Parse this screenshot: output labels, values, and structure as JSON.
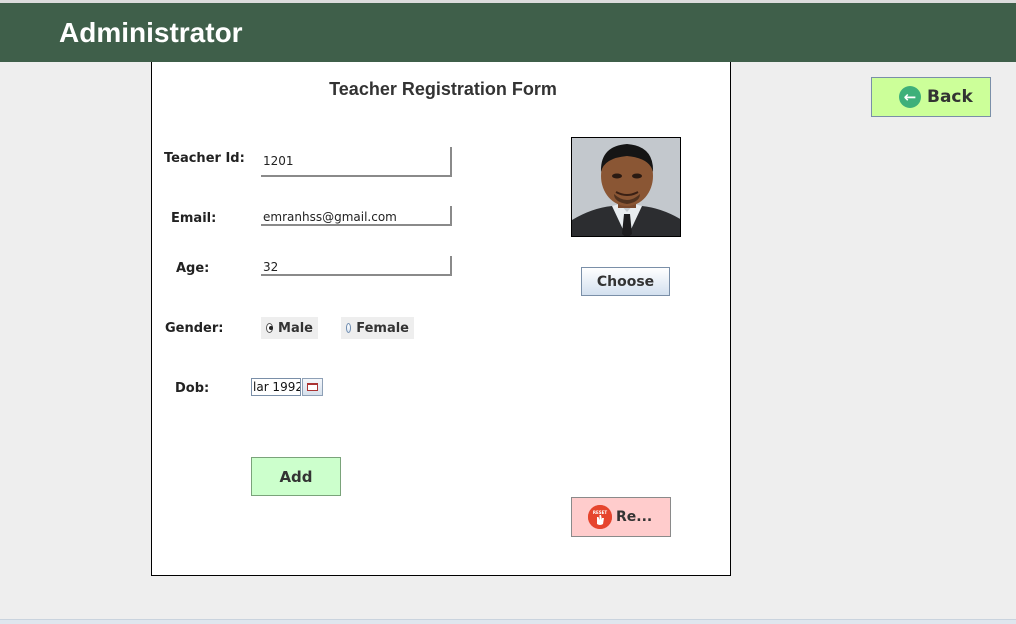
{
  "header": {
    "title": "Administrator"
  },
  "form": {
    "title": "Teacher Registration Form",
    "teacher_id": {
      "label": "Teacher Id:",
      "value": "1201"
    },
    "email": {
      "label": "Email:",
      "value": "emranhss@gmail.com"
    },
    "age": {
      "label": "Age:",
      "value": "32"
    },
    "gender": {
      "label": "Gender:",
      "male": "Male",
      "female": "Female",
      "selected": "Male"
    },
    "dob": {
      "label": "Dob:",
      "value": "lar 1992"
    },
    "add_label": "Add",
    "choose_label": "Choose",
    "reset_label": "Re...",
    "reset_icon_text": "RESET"
  },
  "back_label": "Back",
  "colors": {
    "header_bg": "#3f5f4a",
    "add_bg": "#ccffcc",
    "reset_bg": "#ffcccc",
    "back_bg": "#ccff99"
  }
}
